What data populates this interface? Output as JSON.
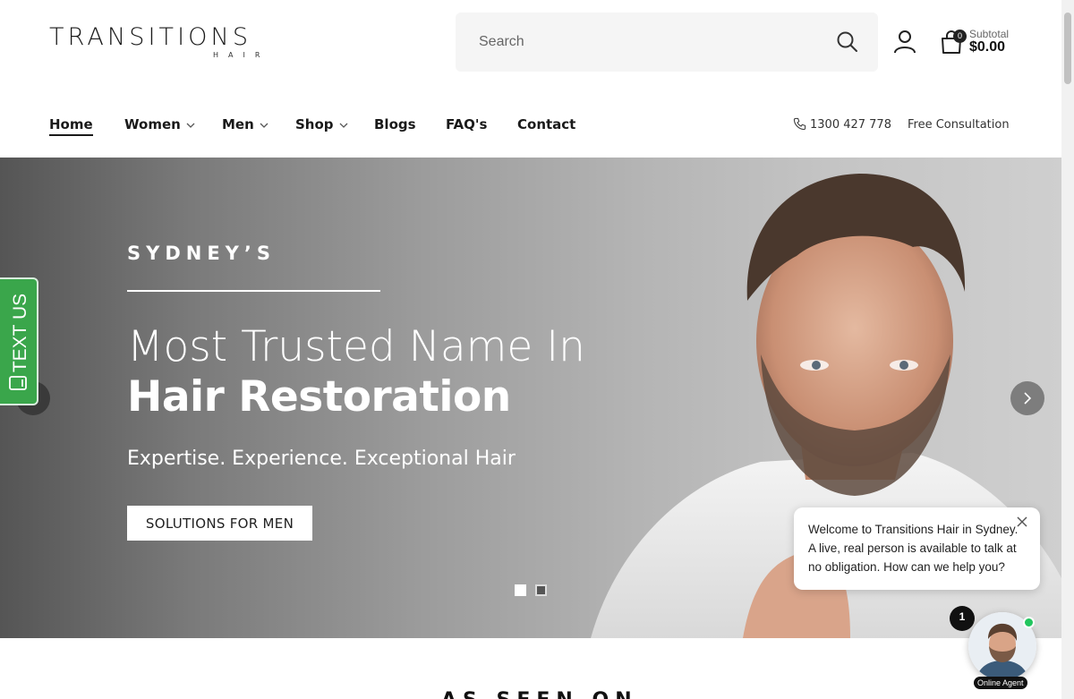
{
  "logo": {
    "main": "TRANSITIONS",
    "sub": "HAIR"
  },
  "search": {
    "placeholder": "Search",
    "icon": "search-icon"
  },
  "header": {
    "account_icon": "user-icon",
    "cart": {
      "count": "0",
      "subtotal_label": "Subtotal",
      "subtotal_value": "$0.00",
      "icon": "shopping-bag-icon"
    }
  },
  "nav": {
    "items": [
      {
        "label": "Home",
        "active": true,
        "dropdown": false
      },
      {
        "label": "Women",
        "active": false,
        "dropdown": true
      },
      {
        "label": "Men",
        "active": false,
        "dropdown": true
      },
      {
        "label": "Shop",
        "active": false,
        "dropdown": true
      },
      {
        "label": "Blogs",
        "active": false,
        "dropdown": false
      },
      {
        "label": "FAQ's",
        "active": false,
        "dropdown": false
      },
      {
        "label": "Contact",
        "active": false,
        "dropdown": false
      }
    ],
    "phone": "1300 427 778",
    "consultation": "Free Consultation"
  },
  "hero": {
    "kicker": "SYDNEY’S",
    "headline_light": "Most Trusted Name In",
    "headline_bold": "Hair Restoration",
    "tagline": "Expertise. Experience. Exceptional Hair",
    "cta": "SOLUTIONS FOR MEN",
    "slides": 2,
    "active_slide": 1
  },
  "text_us": {
    "label": "TEXT US",
    "icon": "mobile-phone-icon",
    "color": "#3aa64b"
  },
  "chat": {
    "message": "Welcome to Transitions Hair in Sydney. A live, real person is available to talk at no obligation. How can we help you?",
    "badge": "1",
    "agent_label": "Online Agent",
    "online_color": "#22c55e"
  },
  "section": {
    "seen_on": "AS SEEN ON"
  }
}
